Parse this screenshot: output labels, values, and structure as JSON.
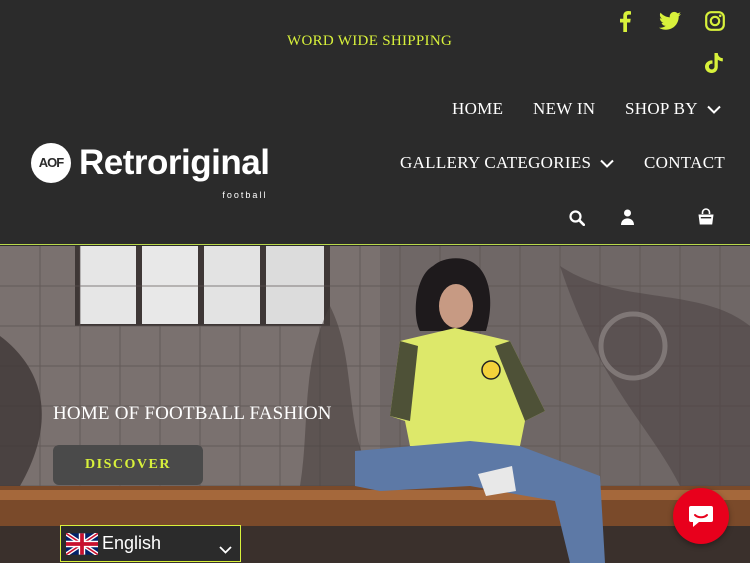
{
  "announcement": "WORD WIDE SHIPPING",
  "social": [
    {
      "icon": "facebook-icon"
    },
    {
      "icon": "twitter-icon"
    },
    {
      "icon": "instagram-icon"
    },
    {
      "icon": "tiktok-icon"
    }
  ],
  "nav": {
    "home": "HOME",
    "new_in": "NEW IN",
    "shop_by": "SHOP BY",
    "gallery": "GALLERY CATEGORIES",
    "contact": "CONTACT"
  },
  "logo": {
    "mark": "AOF",
    "name": "Retroriginal",
    "sub": "football"
  },
  "utility_icons": [
    "search-icon",
    "account-icon",
    "cart-icon"
  ],
  "hero": {
    "title": "HOME OF FOOTBALL FASHION",
    "cta": "DISCOVER"
  },
  "language": {
    "selected": "English",
    "flag": "uk-flag-icon"
  },
  "chat": {
    "icon": "chat-icon"
  },
  "colors": {
    "background": "#2b2b2b",
    "accent": "#d8f13b",
    "text": "#ffffff",
    "chat": "#e8001c"
  }
}
